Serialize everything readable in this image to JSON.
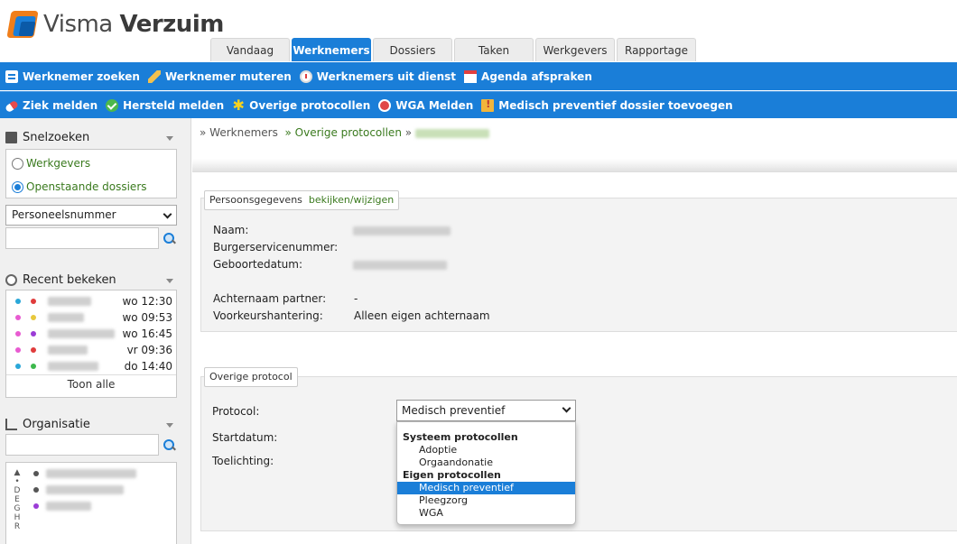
{
  "app": {
    "brand_regular": "Visma",
    "brand_bold": "Verzuim"
  },
  "tabs": [
    "Vandaag",
    "Werknemers",
    "Dossiers",
    "Taken",
    "Werkgevers",
    "Rapportage"
  ],
  "active_tab": "Werknemers",
  "toolbar1": [
    {
      "label": "Werknemer zoeken",
      "icon": "binoculars-icon"
    },
    {
      "label": "Werknemer muteren",
      "icon": "pencil-icon"
    },
    {
      "label": "Werknemers uit dienst",
      "icon": "clock-icon"
    },
    {
      "label": "Agenda afspraken",
      "icon": "calendar-icon"
    }
  ],
  "toolbar2": [
    {
      "label": "Ziek melden",
      "icon": "pill-icon"
    },
    {
      "label": "Hersteld melden",
      "icon": "check-icon"
    },
    {
      "label": "Overige protocollen",
      "icon": "star-icon"
    },
    {
      "label": "WGA Melden",
      "icon": "wga-icon"
    },
    {
      "label": "Medisch preventief dossier toevoegen",
      "icon": "folder-warning-icon"
    }
  ],
  "sidebar": {
    "snelzoeken": {
      "title": "Snelzoeken",
      "radio_options": [
        "Werkgevers",
        "Openstaande dossiers"
      ],
      "selected_radio": "Openstaande dossiers",
      "select_value": "Personeelsnummer"
    },
    "recent": {
      "title": "Recent bekeken",
      "items": [
        {
          "time": "wo 12:30",
          "colors": [
            "#2aa7d8",
            "#e03c3c"
          ]
        },
        {
          "time": "wo 09:53",
          "colors": [
            "#e85bd1",
            "#e8c83c"
          ]
        },
        {
          "time": "wo 16:45",
          "colors": [
            "#e85bd1",
            "#9b3cd6"
          ]
        },
        {
          "time": "vr 09:36",
          "colors": [
            "#e85bd1",
            "#e03c3c"
          ]
        },
        {
          "time": "do 14:40",
          "colors": [
            "#2aa7d8",
            "#3cb84c"
          ]
        }
      ],
      "toon_alle": "Toon alle"
    },
    "organisatie": {
      "title": "Organisatie",
      "alphabet": "D E G H R",
      "rows": [
        {
          "color": "#555555"
        },
        {
          "color": "#555555"
        },
        {
          "color": "#9b3cd6"
        }
      ]
    }
  },
  "breadcrumb": {
    "prefix": "» Werknemers",
    "link": "» Overige protocollen",
    "sep": "»"
  },
  "persoon": {
    "legend": "Persoonsgegevens",
    "edit_link": "bekijken/wijzigen",
    "fields": [
      {
        "label": "Naam:",
        "value": ""
      },
      {
        "label": "Burgerservicenummer:",
        "value": ""
      },
      {
        "label": "Geboortedatum:",
        "value": ""
      },
      {
        "label": "Achternaam partner:",
        "value": "-"
      },
      {
        "label": "Voorkeurshantering:",
        "value": "Alleen eigen achternaam"
      }
    ]
  },
  "protocol": {
    "legend": "Overige protocol",
    "protocol_label": "Protocol:",
    "selected": "Medisch preventief",
    "startdatum_label": "Startdatum:",
    "toelichting_label": "Toelichting:",
    "groups": [
      {
        "name": "Systeem protocollen",
        "options": [
          "Adoptie",
          "Orgaandonatie"
        ]
      },
      {
        "name": "Eigen protocollen",
        "options": [
          "Medisch preventief",
          "Pleegzorg",
          "WGA"
        ]
      }
    ]
  }
}
